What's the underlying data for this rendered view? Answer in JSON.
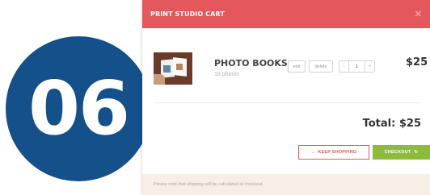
{
  "step": {
    "number": "06",
    "color": "#14508a"
  },
  "cart": {
    "title": "PRINT STUDIO CART",
    "header_color": "#e4575c",
    "close_icon": "close-icon",
    "item": {
      "name": "PHOTO BOOKS",
      "subtitle": "18 photos",
      "edit_label": "edit",
      "delete_label": "delete",
      "qty_minus": "-",
      "quantity": "1",
      "qty_plus": "+",
      "price": "$25",
      "thumbnail_icon": "photo-book-thumbnail"
    },
    "total": "Total: $25",
    "keep_shopping_label": "KEEP SHOPPING",
    "keep_shopping_icon": "arrow-left-icon",
    "checkout_label": "CHECKOUT",
    "checkout_icon": "refresh-icon",
    "checkout_color": "#8dbb3a",
    "note": "Please note that shipping will be calculated at checkout."
  }
}
